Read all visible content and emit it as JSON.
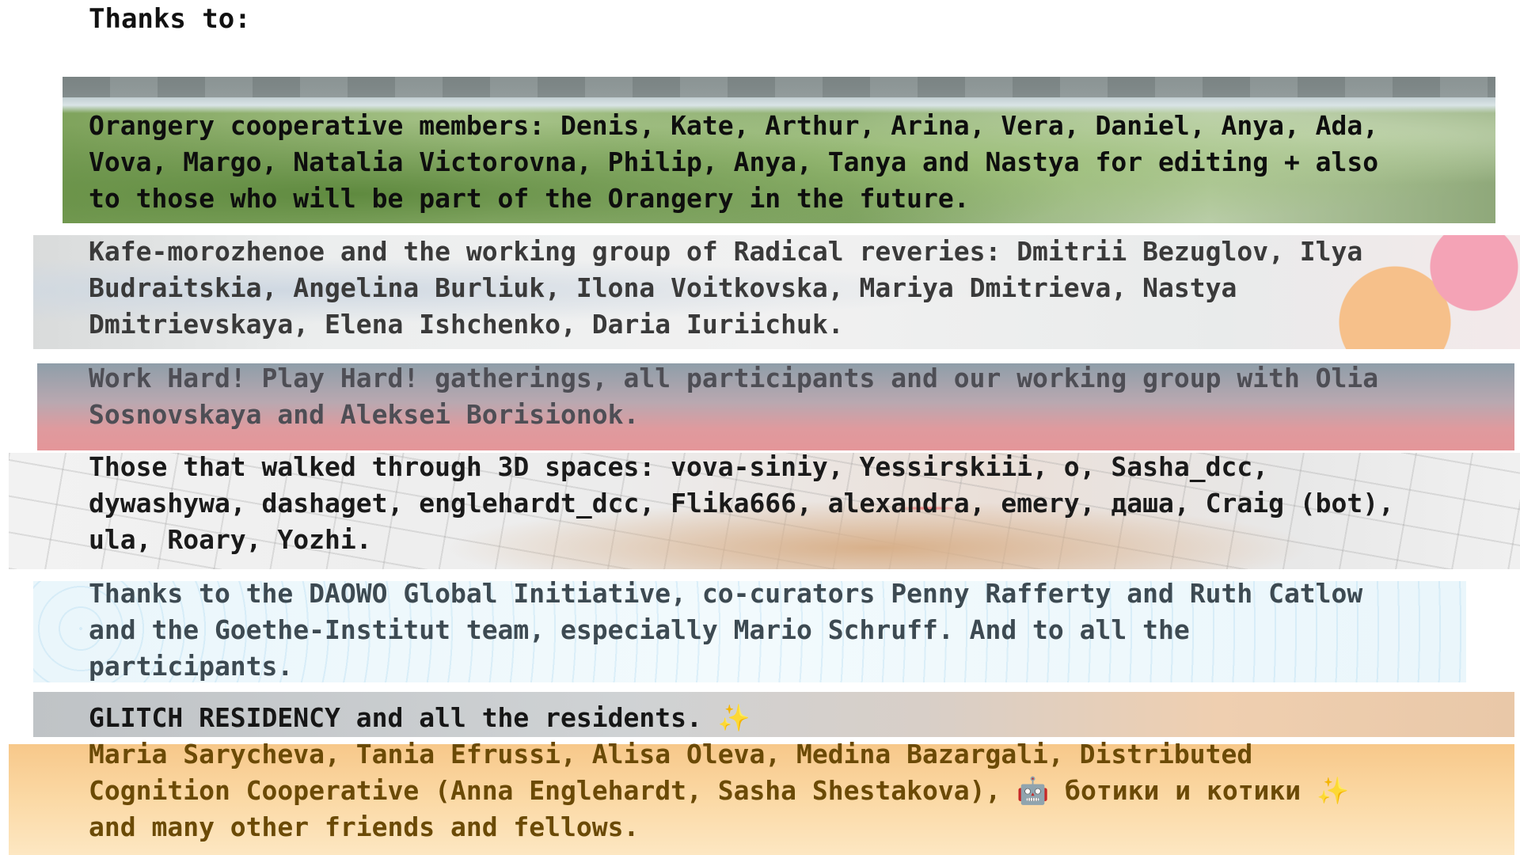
{
  "heading": "Thanks to:",
  "sections": {
    "orangery": "Orangery cooperative members: Denis, Kate, Arthur, Arina, Vera, Daniel, Anya, Ada,\nVova, Margo, Natalia Victorovna, Philip, Anya, Tanya and Nastya for editing + also\nto those who will be part of the Orangery in the future.",
    "kafe": "Kafe-morozhenoe and the working group of Radical reveries: Dmitrii Bezuglov, Ilya\nBudraitskia, Angelina Burliuk, Ilona Voitkovska, Mariya Dmitrieva, Nastya\nDmitrievskaya, Elena Ishchenko, Daria Iuriichuk.",
    "work_hard": "Work Hard! Play Hard! gatherings, all participants and our working group with Olia\nSosnovskaya and Aleksei Borisionok.",
    "spaces_3d": "Those that walked through 3D spaces: vova-siniy, Yessirskiii, o, Sasha_dcc,\ndywashywa, dashaget, englehardt_dcc, Flika666, alexandra, emery, даша, Craig (bot),\nula, Roary, Yozhi.",
    "daowo": "Thanks to the DAOWO Global Initiative, co-curators Penny Rafferty and Ruth Catlow\nand the Goethe-Institut team, especially Mario Schruff. And to all the\nparticipants.",
    "glitch": "GLITCH RESIDENCY and all the residents. ✨",
    "friends": "Maria Sarycheva, Tania Efrussi, Alisa Oleva, Medina Bazargali, Distributed\nCognition Cooperative (Anna Englehardt, Sasha Shestakova), 🤖 ботики и котики ✨\nand many other friends and fellows."
  }
}
